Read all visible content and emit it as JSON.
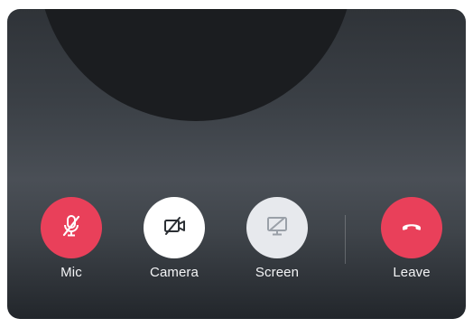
{
  "call_controls": {
    "mic": {
      "label": "Mic",
      "icon": "mic-off-icon",
      "state": "muted",
      "color": "#e9405a"
    },
    "camera": {
      "label": "Camera",
      "icon": "camera-off-icon",
      "state": "off",
      "color": "#ffffff"
    },
    "screen": {
      "label": "Screen",
      "icon": "screen-share-off-icon",
      "state": "off",
      "color": "#e7e9ed"
    },
    "leave": {
      "label": "Leave",
      "icon": "phone-hangup-icon",
      "color": "#e9405a"
    }
  },
  "colors": {
    "accent_red": "#e9405a",
    "panel_background": "#3b4046",
    "avatar": "#1b1d20"
  }
}
